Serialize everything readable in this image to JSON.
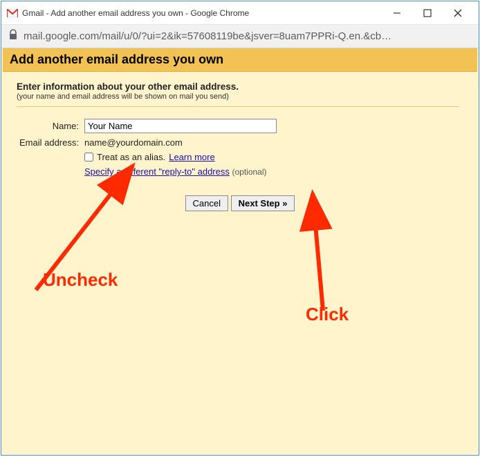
{
  "window": {
    "title": "Gmail - Add another email address you own - Google Chrome"
  },
  "address": {
    "lock": "🔒",
    "url": "mail.google.com/mail/u/0/?ui=2&ik=57608119be&jsver=8uam7PPRi-Q.en.&cb…"
  },
  "page": {
    "heading": "Add another email address you own",
    "subtitle": "Enter information about your other email address.",
    "note": "(your name and email address will be shown on mail you send)",
    "labels": {
      "name": "Name:",
      "email": "Email address:"
    },
    "name_value": "Your Name",
    "email_value": "name@yourdomain.com",
    "alias_label": "Treat as an alias.",
    "learn_more": "Learn more",
    "replyto_link": "Specify a different \"reply-to\" address",
    "optional": "(optional)",
    "cancel": "Cancel",
    "next": "Next Step »"
  },
  "annotations": {
    "uncheck": "Uncheck",
    "click": "Click"
  }
}
